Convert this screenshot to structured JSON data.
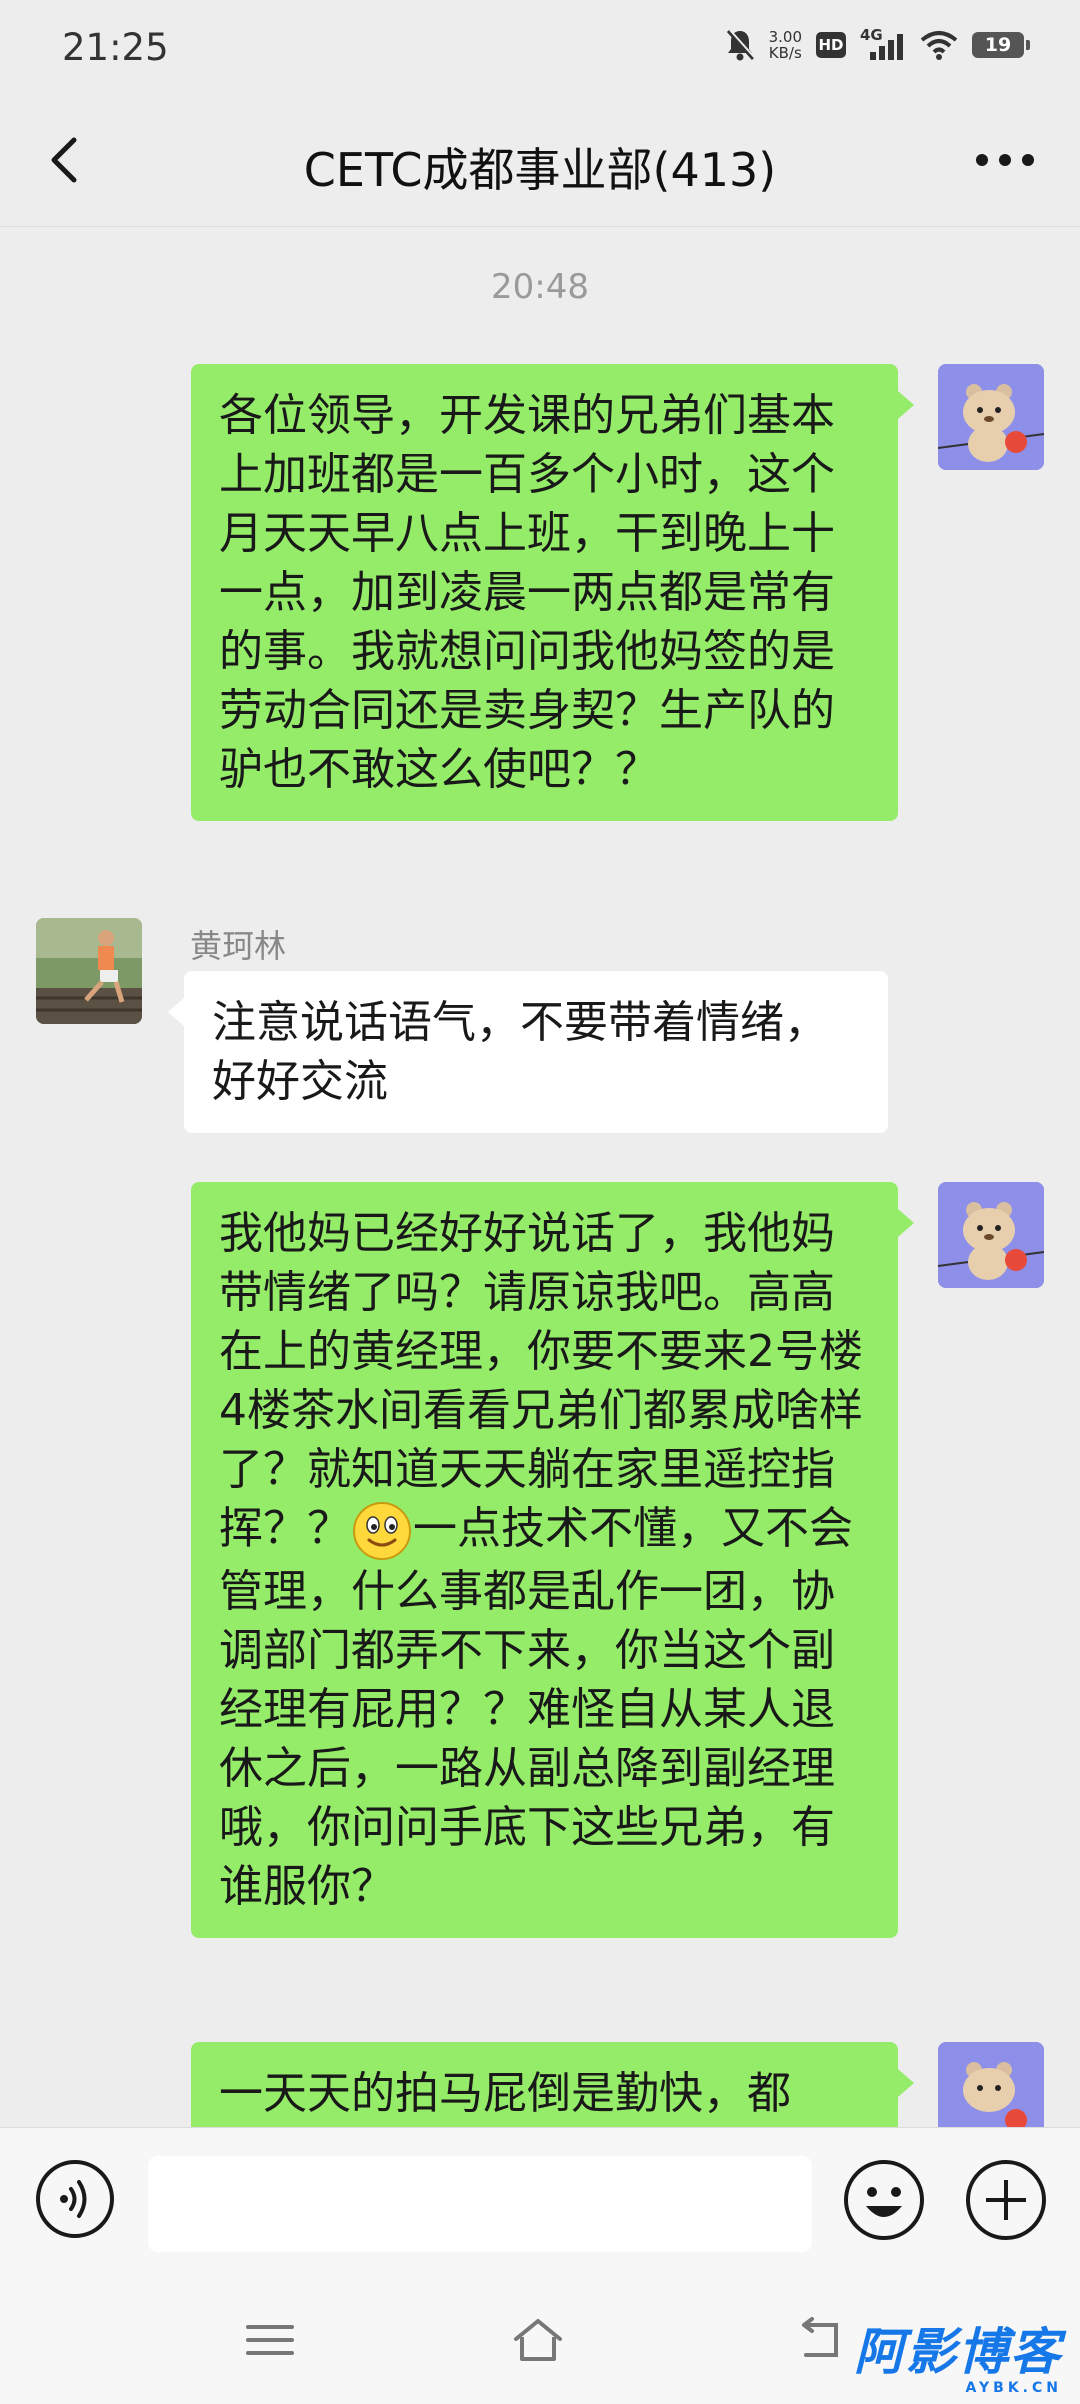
{
  "status_bar": {
    "time": "21:25",
    "net_speed_value": "3.00",
    "net_speed_unit": "KB/s",
    "hd": "HD",
    "signal": "4G",
    "battery": "19"
  },
  "header": {
    "title": "CETC成都事业部(413)"
  },
  "chat": {
    "timestamp": "20:48",
    "messages": [
      {
        "sender": "me",
        "text": "各位领导，开发课的兄弟们基本上加班都是一百多个小时，这个月天天早八点上班，干到晚上十一点，加到凌晨一两点都是常有的事。我就想问问我他妈签的是劳动合同还是卖身契？生产队的驴也不敢这么使吧？？"
      },
      {
        "sender": "other",
        "name": "黄珂林",
        "text": "注意说话语气，不要带着情绪，好好交流"
      },
      {
        "sender": "me",
        "text_before_emoji": "我他妈已经好好说话了，我他妈带情绪了吗？请原谅我吧。高高在上的黄经理，你要不要来2号楼4楼茶水间看看兄弟们都累成啥样了？就知道天天躺在家里遥控指挥？？",
        "emoji": "smile-emoji",
        "text_after_emoji": "一点技术不懂，又不会管理，什么事都是乱作一团，协调部门都弄不下来，你当这个副经理有屁用？？难怪自从某人退休之后，一路从副总降到副经理哦，你问问手底下这些兄弟，有谁服你？"
      },
      {
        "sender": "me",
        "text": "一天天的拍马屁倒是勤快，都"
      }
    ]
  },
  "input_bar": {
    "voice_icon": "voice-icon",
    "emoji_icon": "emoji-icon",
    "plus_icon": "plus-icon",
    "value": ""
  },
  "watermark": {
    "text": "阿影博客",
    "domain": "AYBK.CN"
  },
  "colors": {
    "background": "#ededed",
    "my_bubble": "#95ec69",
    "other_bubble": "#ffffff",
    "watermark": "#1577e8"
  }
}
